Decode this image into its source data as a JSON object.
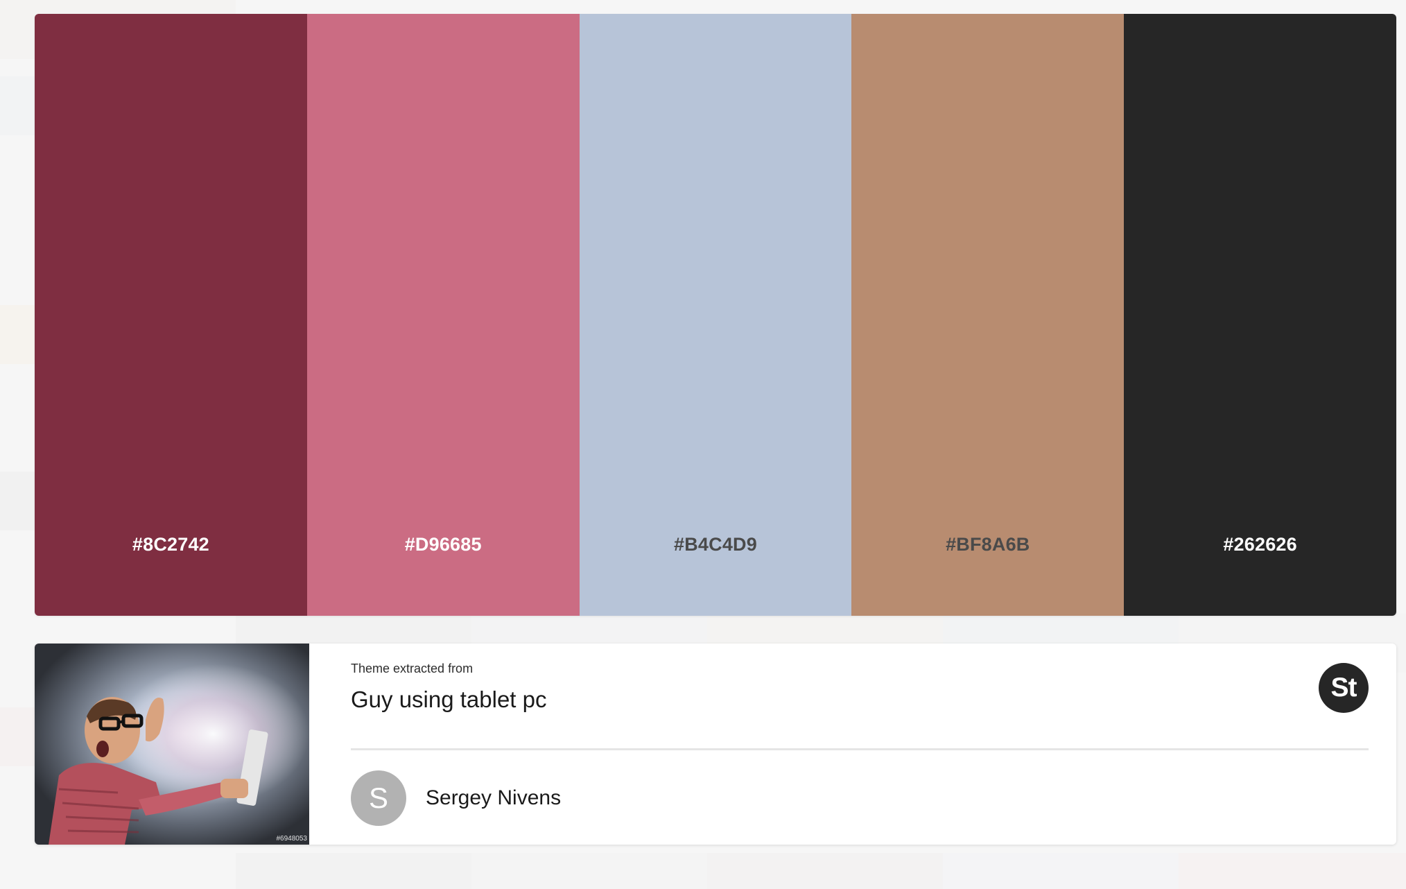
{
  "palette": {
    "swatches": [
      {
        "hex": "#8C2742",
        "color": "#7f2e41",
        "text_color": "#ffffff"
      },
      {
        "hex": "#D96685",
        "color": "#cb6c83",
        "text_color": "#ffffff"
      },
      {
        "hex": "#B4C4D9",
        "color": "#b7c4d8",
        "text_color": "#4a4a4a"
      },
      {
        "hex": "#BF8A6B",
        "color": "#b88c70",
        "text_color": "#4a4a4a"
      },
      {
        "hex": "#262626",
        "color": "#262626",
        "text_color": "#ffffff"
      }
    ]
  },
  "source": {
    "label": "Theme extracted from",
    "title": "Guy using tablet pc",
    "thumbnail_id": "#6948053",
    "badge": "St"
  },
  "author": {
    "initial": "S",
    "name": "Sergey Nivens"
  },
  "icons": {
    "stock_badge": "adobe-stock-icon",
    "avatar": "user-avatar-icon"
  }
}
